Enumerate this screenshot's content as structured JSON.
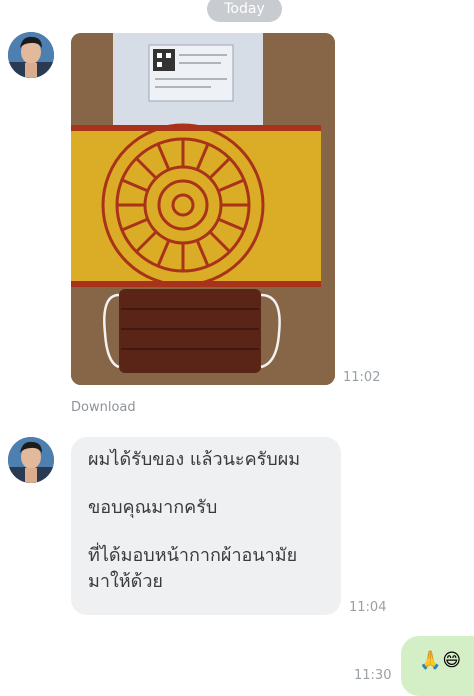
{
  "date_separator": "Today",
  "messages": [
    {
      "type": "image",
      "time": "11:02",
      "download_label": "Download"
    },
    {
      "type": "text",
      "time": "11:04",
      "lines": [
        "ผมได้รับของ แล้วนะครับผม",
        "ขอบคุณมากครับ",
        "ที่ได้มอบหน้ากากผ้าอนามัย",
        "มาให้ด้วย"
      ]
    },
    {
      "type": "outgoing",
      "time": "11:30",
      "emoji": "🙏😄"
    }
  ],
  "colors": {
    "incoming_bubble": "#eef0f2",
    "outgoing_bubble": "#d4efc6",
    "timestamp": "#9aa0a6",
    "date_pill": "#c8cbcf"
  }
}
